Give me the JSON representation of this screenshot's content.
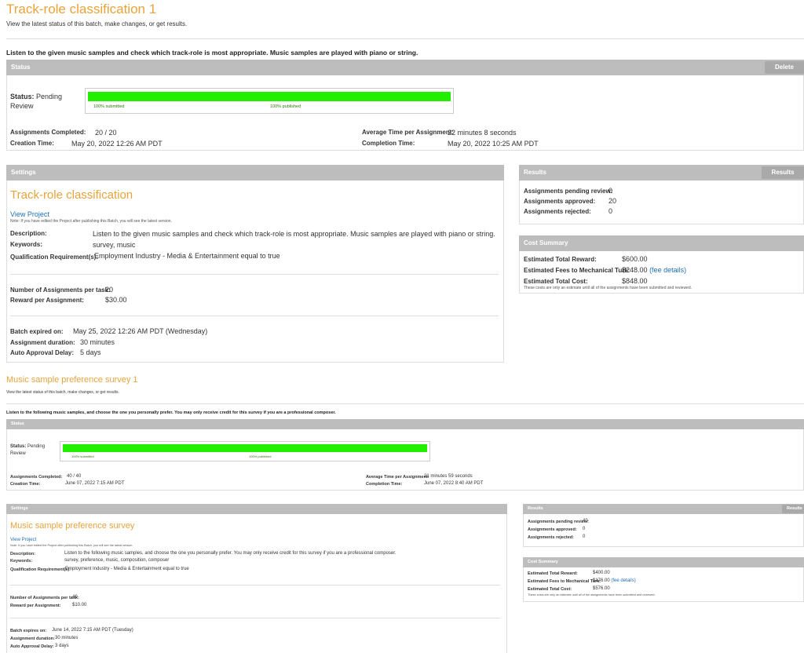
{
  "batches": [
    {
      "title": "Track-role classification 1",
      "subtitle": "View the latest status of this batch, make changes, or get results.",
      "description": "Listen to the given music samples and check which track-role is most appropriate. Music samples are played with piano or string.",
      "status": {
        "header": "Status",
        "delete_label": "Delete",
        "status_label": "Status:",
        "status_value": "Pending",
        "status_value2": "Review",
        "submitted_label": "100% submitted",
        "published_label": "100% published",
        "submitted_pct": 100,
        "published_pct": 100,
        "assignments_completed_label": "Assignments Completed:",
        "assignments_completed": "20 / 20",
        "creation_time_label": "Creation Time:",
        "creation_time": "May 20, 2022 12:26 AM PDT",
        "avg_time_label": "Average Time per Assignment:",
        "avg_time": "22 minutes 8 seconds",
        "completion_time_label": "Completion Time:",
        "completion_time": "May 20, 2022 10:25 AM PDT"
      },
      "settings": {
        "header": "Settings",
        "project_name": "Track-role classification",
        "view_project": "View Project",
        "note": "Note: If you have edited the Project after publishing this Batch, you will see the latest version.",
        "description_label": "Description:",
        "description_value": "Listen to the given music samples and check which track-role is most appropriate. Music samples are played with piano or string.",
        "keywords_label": "Keywords:",
        "keywords_value": "survey, music",
        "qualification_label": "Qualification Requirement(s):",
        "qualification_value": "Employment Industry - Media & Entertainment equal to true",
        "num_assignments_label": "Number of Assignments per task:",
        "num_assignments_value": "20",
        "reward_label": "Reward per Assignment:",
        "reward_value": "$30.00",
        "expires_label": "Batch expired on:",
        "expires_value": "May 25, 2022 12:26 AM PDT (Wednesday)",
        "duration_label": "Assignment duration:",
        "duration_value": "30 minutes",
        "auto_approval_label": "Auto Approval Delay:",
        "auto_approval_value": "5 days"
      },
      "results": {
        "header": "Results",
        "button_label": "Results",
        "pending_label": "Assignments pending review:",
        "pending_value": "0",
        "approved_label": "Assignments approved:",
        "approved_value": "20",
        "rejected_label": "Assignments rejected:",
        "rejected_value": "0"
      },
      "cost": {
        "header": "Cost Summary",
        "reward_label": "Estimated Total Reward:",
        "reward_value": "$600.00",
        "fees_label": "Estimated Fees to Mechanical Turk:",
        "fees_value": "$248.00",
        "fee_details": "(fee details)",
        "total_label": "Estimated Total Cost:",
        "total_value": "$848.00",
        "note": "These costs are only an estimate until all of the assignments have been submitted and reviewed."
      }
    },
    {
      "title": "Music sample preference survey 1",
      "subtitle": "View the latest status of this batch, make changes, or get results.",
      "description": "Listen to the following music samples, and choose the one you personally prefer. You may only receive credit for this survey if you are a professional composer.",
      "status": {
        "header": "Status",
        "status_label": "Status:",
        "status_value": "Pending",
        "status_value2": "Review",
        "submitted_label": "100% submitted",
        "published_label": "100% published",
        "submitted_pct": 100,
        "published_pct": 100,
        "assignments_completed_label": "Assignments Completed:",
        "assignments_completed": "40 / 40",
        "creation_time_label": "Creation Time:",
        "creation_time": "June 07, 2022 7:15 AM PDT",
        "avg_time_label": "Average Time per Assignment:",
        "avg_time": "21 minutes 59 seconds",
        "completion_time_label": "Completion Time:",
        "completion_time": "June 07, 2022 8:40 AM PDT"
      },
      "settings": {
        "header": "Settings",
        "project_name": "Music sample preference survey",
        "view_project": "View Project",
        "note": "Note: If you have edited the Project after publishing this Batch, you will see the latest version.",
        "description_label": "Description:",
        "description_value": "Listen to the following music samples, and choose the one you personally prefer. You may only receive credit for this survey if you are a professional composer.",
        "keywords_label": "Keywords:",
        "keywords_value": "survey, preference, music, composition, composer",
        "qualification_label": "Qualification Requirement(s):",
        "qualification_value": "Employment Industry - Media & Entertainment equal to true",
        "num_assignments_label": "Number of Assignments per task:",
        "num_assignments_value": "40",
        "reward_label": "Reward per Assignment:",
        "reward_value": "$10.00",
        "expires_label": "Batch expires on:",
        "expires_value": "June 14, 2022 7:15 AM PDT (Tuesday)",
        "duration_label": "Assignment duration:",
        "duration_value": "30 minutes",
        "auto_approval_label": "Auto Approval Delay:",
        "auto_approval_value": "3 days"
      },
      "results": {
        "header": "Results",
        "button_label": "Results",
        "pending_label": "Assignments pending review:",
        "pending_value": "40",
        "approved_label": "Assignments approved:",
        "approved_value": "0",
        "rejected_label": "Assignments rejected:",
        "rejected_value": "0"
      },
      "cost": {
        "header": "Cost Summary",
        "reward_label": "Estimated Total Reward:",
        "reward_value": "$400.00",
        "fees_label": "Estimated Fees to Mechanical Turk:",
        "fees_value": "$176.00",
        "fee_details": "(fee details)",
        "total_label": "Estimated Total Cost:",
        "total_value": "$576.00",
        "note": "These costs are only an estimate until all of the assignments have been submitted and reviewed."
      }
    }
  ]
}
